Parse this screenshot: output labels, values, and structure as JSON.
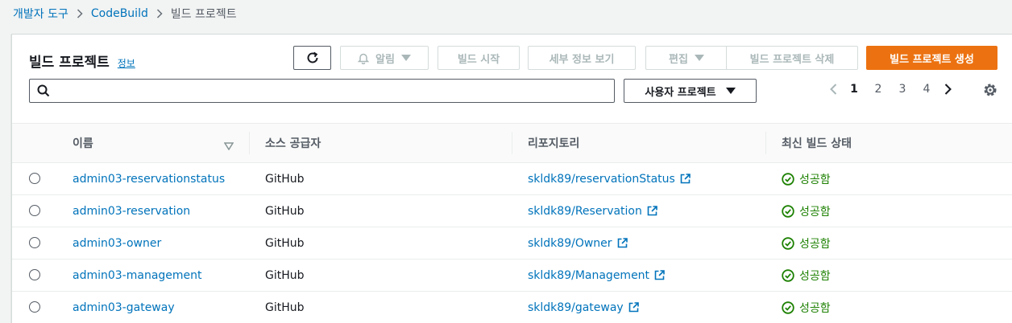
{
  "breadcrumb": {
    "items": [
      "개발자 도구",
      "CodeBuild"
    ],
    "current": "빌드 프로젝트"
  },
  "header": {
    "title": "빌드 프로젝트",
    "info_link": "정보"
  },
  "toolbar": {
    "refresh_icon": "refresh-icon",
    "notify_label": "알림",
    "start_build_label": "빌드 시작",
    "view_details_label": "세부 정보 보기",
    "edit_label": "편집",
    "delete_label": "빌드 프로젝트 삭제",
    "create_label": "빌드 프로젝트 생성"
  },
  "filter": {
    "search_value": "",
    "search_placeholder": "",
    "project_select": "사용자 프로젝트"
  },
  "pagination": {
    "pages": [
      "1",
      "2",
      "3",
      "4"
    ],
    "current_page": "1"
  },
  "table": {
    "columns": [
      "이름",
      "소스 공급자",
      "리포지토리",
      "최신 빌드 상태"
    ],
    "rows": [
      {
        "name": "admin03-reservationstatus",
        "provider": "GitHub",
        "repository": "skldk89/reservationStatus",
        "status": "성공함"
      },
      {
        "name": "admin03-reservation",
        "provider": "GitHub",
        "repository": "skldk89/Reservation",
        "status": "성공함"
      },
      {
        "name": "admin03-owner",
        "provider": "GitHub",
        "repository": "skldk89/Owner",
        "status": "성공함"
      },
      {
        "name": "admin03-management",
        "provider": "GitHub",
        "repository": "skldk89/Management",
        "status": "성공함"
      },
      {
        "name": "admin03-gateway",
        "provider": "GitHub",
        "repository": "skldk89/gateway",
        "status": "성공함"
      }
    ]
  },
  "colors": {
    "link": "#0073bb",
    "primary_button": "#ec7211",
    "success": "#1d8102",
    "disabled_text": "#aab7b8"
  }
}
